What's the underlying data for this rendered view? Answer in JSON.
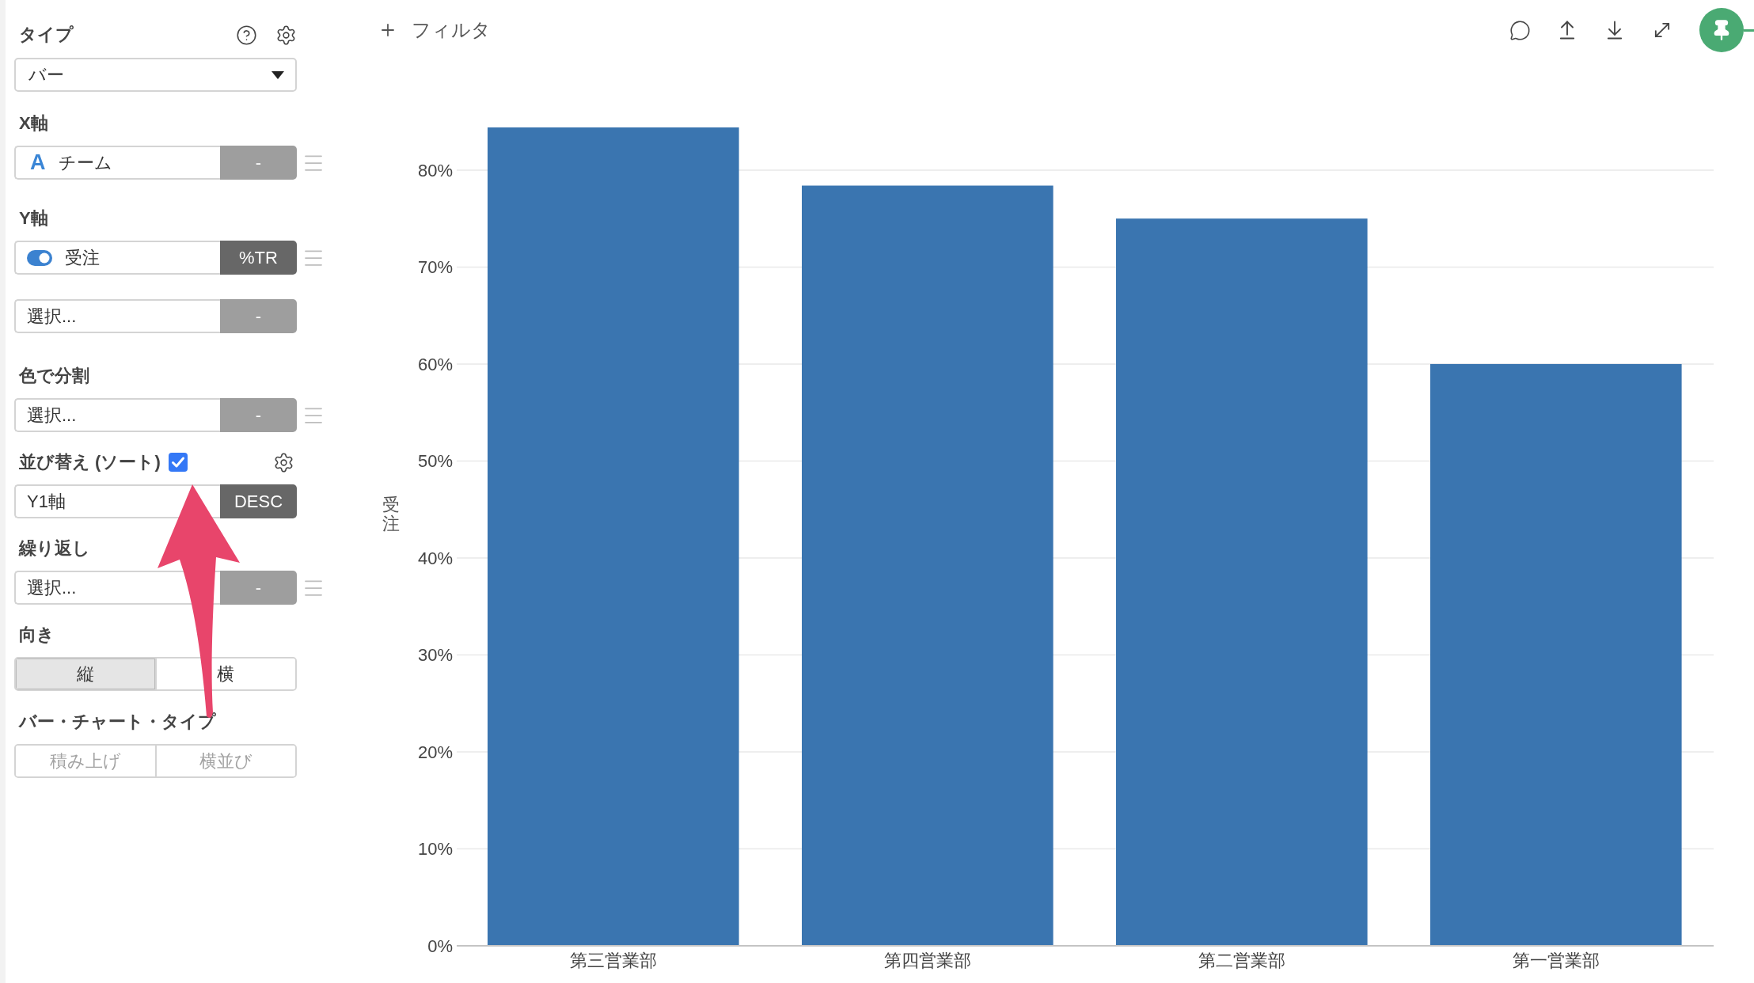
{
  "toolbar": {
    "filter_label": "フィルタ"
  },
  "sidebar": {
    "sections": [
      {
        "kind": "dropdown",
        "label": "タイプ",
        "value": "バー"
      },
      {
        "kind": "fields",
        "label": "X軸",
        "fields": [
          {
            "kind": "text",
            "badge": "A",
            "value": "チーム",
            "option": "-",
            "active": false,
            "handle": true
          }
        ]
      },
      {
        "kind": "fields",
        "label": "Y軸",
        "fields": [
          {
            "kind": "toggle",
            "on": true,
            "value": "受注",
            "option": "%TR",
            "active": true,
            "handle": true
          },
          {
            "kind": "plain",
            "placeholder": "選択...",
            "option": "-",
            "active": false,
            "handle": false
          }
        ]
      },
      {
        "kind": "fields",
        "label": "色で分割",
        "fields": [
          {
            "kind": "plain",
            "placeholder": "選択...",
            "option": "-",
            "active": false,
            "handle": true
          }
        ]
      },
      {
        "kind": "sort",
        "label": "並び替え (ソート)",
        "checked": true,
        "fields": [
          {
            "kind": "plain",
            "value": "Y1軸",
            "option": "DESC",
            "active": true,
            "handle": false
          }
        ]
      },
      {
        "kind": "fields",
        "label": "繰り返し",
        "fields": [
          {
            "kind": "plain",
            "placeholder": "選択...",
            "option": "-",
            "active": false,
            "handle": true
          }
        ]
      },
      {
        "kind": "segmented",
        "label": "向き",
        "disabled": false,
        "options": [
          {
            "label": "縦",
            "selected": true
          },
          {
            "label": "横",
            "selected": false
          }
        ]
      },
      {
        "kind": "segmented",
        "label": "バー・チャート・タイプ",
        "disabled": true,
        "options": [
          {
            "label": "積み上げ",
            "selected": false
          },
          {
            "label": "横並び",
            "selected": false
          }
        ]
      }
    ]
  },
  "chart": {
    "chart_data": {
      "type": "bar",
      "ylabel": "受注",
      "categories": [
        "第三営業部",
        "第四営業部",
        "第二営業部",
        "第一営業部"
      ],
      "values": [
        84.4,
        78.4,
        75.0,
        60.0
      ],
      "grid": true,
      "ylim": [
        0,
        84.4
      ],
      "yticks": [
        {
          "value": 0,
          "label": "0%"
        },
        {
          "value": 10,
          "label": "10%"
        },
        {
          "value": 20,
          "label": "20%"
        },
        {
          "value": 30,
          "label": "30%"
        },
        {
          "value": 40,
          "label": "40%"
        },
        {
          "value": 50,
          "label": "50%"
        },
        {
          "value": 60,
          "label": "60%"
        },
        {
          "value": 70,
          "label": "70%"
        },
        {
          "value": 80,
          "label": "80%"
        }
      ]
    }
  }
}
